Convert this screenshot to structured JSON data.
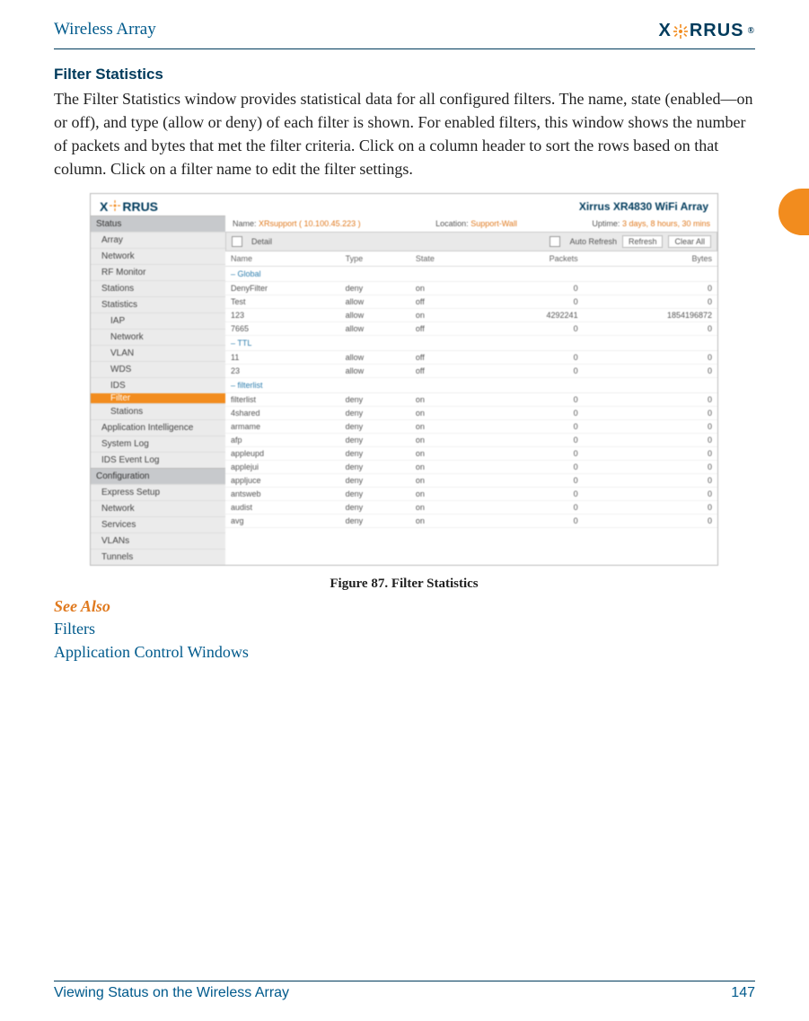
{
  "header": {
    "doc_title": "Wireless Array",
    "brand": "XIRRUS"
  },
  "section": {
    "heading": "Filter Statistics",
    "body": "The Filter Statistics window provides statistical data for all configured filters. The name, state (enabled—on or off), and type (allow or deny) of each filter is shown. For enabled filters, this window shows the number of packets and bytes that met the filter criteria. Click on a column header to sort the rows based on that column. Click on a filter name to edit the filter settings."
  },
  "screenshot": {
    "product": "Xirrus XR4830 WiFi Array",
    "status": {
      "name_label": "Name:",
      "name_value": "XRsupport ( 10.100.45.223 )",
      "location_label": "Location:",
      "location_value": "Support-Wall",
      "uptime_label": "Uptime:",
      "uptime_value": "3 days, 8 hours, 30 mins"
    },
    "toolbar": {
      "detail": "Detail",
      "auto_refresh": "Auto Refresh",
      "refresh": "Refresh",
      "clear_all": "Clear All"
    },
    "sidebar": {
      "group_status": "Status",
      "items_status": [
        "Array",
        "Network",
        "RF Monitor",
        "Stations",
        "Statistics"
      ],
      "stats_sub": [
        "IAP",
        "Network",
        "VLAN",
        "WDS",
        "IDS",
        "Filter",
        "Stations"
      ],
      "items_status2": [
        "Application Intelligence",
        "System Log",
        "IDS Event Log"
      ],
      "group_config": "Configuration",
      "items_config": [
        "Express Setup",
        "Network",
        "Services",
        "VLANs",
        "Tunnels"
      ]
    },
    "columns": [
      "Name",
      "Type",
      "State",
      "Packets",
      "Bytes"
    ],
    "groups": [
      {
        "label": "– Global",
        "rows": [
          {
            "name": "DenyFilter",
            "type": "deny",
            "state": "on",
            "packets": "0",
            "bytes": "0"
          },
          {
            "name": "Test",
            "type": "allow",
            "state": "off",
            "packets": "0",
            "bytes": "0"
          },
          {
            "name": "123",
            "type": "allow",
            "state": "on",
            "packets": "4292241",
            "bytes": "1854196872"
          },
          {
            "name": "7665",
            "type": "allow",
            "state": "off",
            "packets": "0",
            "bytes": "0"
          }
        ]
      },
      {
        "label": "– TTL",
        "rows": [
          {
            "name": "11",
            "type": "allow",
            "state": "off",
            "packets": "0",
            "bytes": "0"
          },
          {
            "name": "23",
            "type": "allow",
            "state": "off",
            "packets": "0",
            "bytes": "0"
          }
        ]
      },
      {
        "label": "– filterlist",
        "rows": [
          {
            "name": "filterlist",
            "type": "deny",
            "state": "on",
            "packets": "0",
            "bytes": "0"
          },
          {
            "name": "4shared",
            "type": "deny",
            "state": "on",
            "packets": "0",
            "bytes": "0"
          },
          {
            "name": "armame",
            "type": "deny",
            "state": "on",
            "packets": "0",
            "bytes": "0"
          },
          {
            "name": "afp",
            "type": "deny",
            "state": "on",
            "packets": "0",
            "bytes": "0"
          },
          {
            "name": "appleupd",
            "type": "deny",
            "state": "on",
            "packets": "0",
            "bytes": "0"
          },
          {
            "name": "applejui",
            "type": "deny",
            "state": "on",
            "packets": "0",
            "bytes": "0"
          },
          {
            "name": "appljuce",
            "type": "deny",
            "state": "on",
            "packets": "0",
            "bytes": "0"
          },
          {
            "name": "antsweb",
            "type": "deny",
            "state": "on",
            "packets": "0",
            "bytes": "0"
          },
          {
            "name": "audist",
            "type": "deny",
            "state": "on",
            "packets": "0",
            "bytes": "0"
          },
          {
            "name": "avg",
            "type": "deny",
            "state": "on",
            "packets": "0",
            "bytes": "0"
          }
        ]
      }
    ]
  },
  "caption": "Figure 87. Filter Statistics",
  "see_also": {
    "heading": "See Also",
    "links": [
      "Filters",
      "Application Control Windows"
    ]
  },
  "footer": {
    "chapter": "Viewing Status on the Wireless Array",
    "page": "147"
  }
}
